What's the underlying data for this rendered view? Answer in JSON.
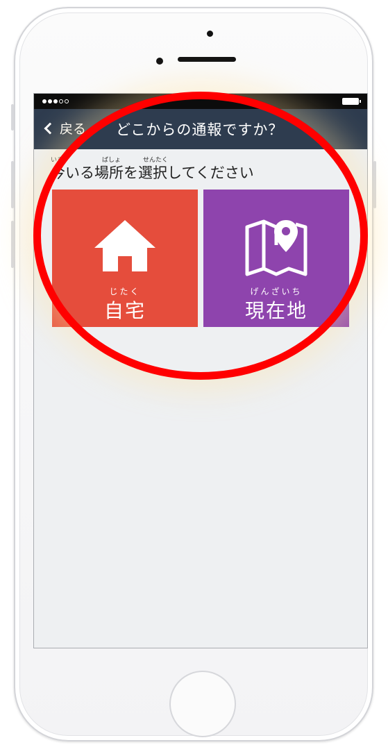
{
  "status_bar": {
    "carrier_dots": 5,
    "filled_dots": 3
  },
  "nav": {
    "back_label": "戻る",
    "title": "どこからの通報ですか？"
  },
  "prompt": {
    "text": "今いる場所を選択してください",
    "ruby_ima": "いま",
    "ruby_basho": "ばしょ",
    "ruby_sentaku": "せんたく"
  },
  "tiles": [
    {
      "furigana": "じたく",
      "label": "自宅",
      "icon": "house-icon",
      "color": "#e54d3c"
    },
    {
      "furigana": "げんざいち",
      "label": "現在地",
      "icon": "map-pin-icon",
      "color": "#8e44ad"
    }
  ],
  "colors": {
    "nav_bar": "#2e3c4f",
    "annotation": "#ff0000",
    "screen_bg": "#eef0f2"
  }
}
